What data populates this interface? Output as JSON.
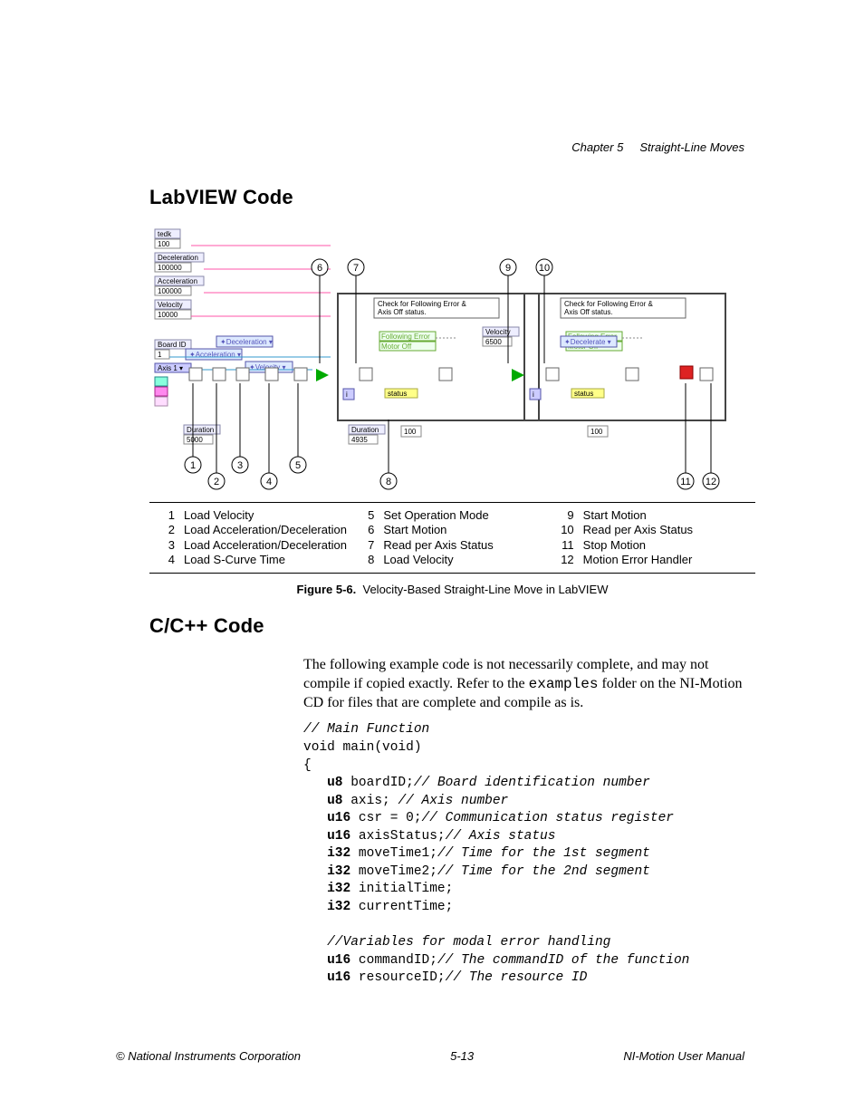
{
  "header": {
    "chapter": "Chapter 5",
    "chapter_title": "Straight-Line Moves"
  },
  "sections": {
    "s1": "LabVIEW Code",
    "s2": "C/C++ Code"
  },
  "diagram": {
    "bubbles": [
      "1",
      "2",
      "3",
      "4",
      "5",
      "6",
      "7",
      "8",
      "9",
      "10",
      "11",
      "12"
    ],
    "node_labels": {
      "tedk": "tedk",
      "num100": "100",
      "deceleration": "Deceleration",
      "val100000a": "100000",
      "acceleration": "Acceleration",
      "val100000b": "100000",
      "velocity": "Velocity",
      "val10000": "10000",
      "boardid": "Board ID",
      "val1": "1",
      "axis1": "Axis 1",
      "duration1": "Duration",
      "dur1val": "5000",
      "velocity2": "Velocity",
      "vel2val": "6500",
      "duration2": "Duration",
      "dur2val": "4935",
      "check1": "Check for Following Error &\nAxis Off status.",
      "check2": "Check for Following Error &\nAxis Off status.",
      "fe1a": "Following Error",
      "fe1b": "Motor Off",
      "fe2a": "Following Error",
      "fe2b": "Motor Off",
      "decdrop": "Deceleration",
      "accdrop": "Acceleration",
      "veldrop": "Velocity",
      "decstop": "Decelerate",
      "status1": "status",
      "status2": "status",
      "numi1": "i",
      "numi2": "i",
      "box100a": "100",
      "box100b": "100"
    }
  },
  "legend": {
    "col1": [
      {
        "n": "1",
        "t": "Load Velocity"
      },
      {
        "n": "2",
        "t": "Load Acceleration/Deceleration"
      },
      {
        "n": "3",
        "t": "Load Acceleration/Deceleration"
      },
      {
        "n": "4",
        "t": "Load S-Curve Time"
      }
    ],
    "col2": [
      {
        "n": "5",
        "t": "Set Operation Mode"
      },
      {
        "n": "6",
        "t": "Start Motion"
      },
      {
        "n": "7",
        "t": "Read per Axis Status"
      },
      {
        "n": "8",
        "t": "Load Velocity"
      }
    ],
    "col3": [
      {
        "n": "9",
        "t": "Start Motion"
      },
      {
        "n": "10",
        "t": "Read per Axis Status"
      },
      {
        "n": "11",
        "t": "Stop Motion"
      },
      {
        "n": "12",
        "t": "Motion Error Handler"
      }
    ]
  },
  "figure": {
    "label": "Figure 5-6.",
    "caption": "Velocity-Based Straight-Line Move in LabVIEW"
  },
  "body": {
    "p1a": "The following example code is not necessarily complete, and may not compile if copied exactly. Refer to the ",
    "p1code": "examples",
    "p1b": " folder on the NI-Motion CD for files that are complete and compile as is."
  },
  "code": {
    "l1": "// Main Function",
    "l2": "void main(void)",
    "l3": "{",
    "l4a": "u8",
    "l4b": " boardID;",
    "l4c": "// Board identification number",
    "l5a": "u8",
    "l5b": " axis; ",
    "l5c": "// Axis number",
    "l6a": "u16",
    "l6b": " csr = 0;",
    "l6c": "// Communication status register",
    "l7a": "u16",
    "l7b": " axisStatus;",
    "l7c": "// Axis status",
    "l8a": "i32",
    "l8b": " moveTime1;",
    "l8c": "// Time for the 1st segment",
    "l9a": "i32",
    "l9b": " moveTime2;",
    "l9c": "// Time for the 2nd segment",
    "l10a": "i32",
    "l10b": " initialTime;",
    "l11a": "i32",
    "l11b": " currentTime;",
    "l12": "//Variables for modal error handling",
    "l13a": "u16",
    "l13b": " commandID;",
    "l13c": "// The commandID of the function",
    "l14a": "u16",
    "l14b": " resourceID;",
    "l14c": "// The resource ID"
  },
  "footer": {
    "left": "© National Instruments Corporation",
    "center": "5-13",
    "right": "NI-Motion User Manual"
  }
}
